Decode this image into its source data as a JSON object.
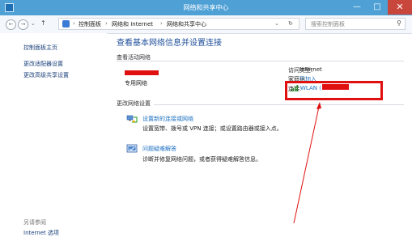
{
  "window": {
    "title": "网络和共享中心",
    "minimize": "—",
    "maximize": "□",
    "close": "✕"
  },
  "nav": {
    "back": "←",
    "forward": "→",
    "up": "↑",
    "refresh": "↻",
    "dropdown": "⌄"
  },
  "breadcrumb": [
    "控制面板",
    "网络和 Internet",
    "网络和共享中心"
  ],
  "breadcrumb_sep": "›",
  "search": {
    "placeholder": "搜索控制面板",
    "icon": "magnifier-icon"
  },
  "sidebar": {
    "links": [
      "控制面板主页",
      "更改适配器设置",
      "更改高级共享设置"
    ],
    "see_also_title": "另请参阅",
    "see_also": [
      "Internet 选项"
    ]
  },
  "main": {
    "heading": "查看基本网络信息并设置连接",
    "active_networks_title": "查看活动网络",
    "network_type": "专用网络",
    "access_type_label": "访问类型:",
    "access_type_value": "Internet",
    "homegroup_label": "家庭组:",
    "homegroup_value": "已加入",
    "connections_label": "连接:",
    "connection_value": "WLAN (",
    "change_settings_title": "更改网络设置",
    "tasks": [
      {
        "title": "设置新的连接或网络",
        "desc": "设置宽带、拨号或 VPN 连接；或设置路由器或接入点。",
        "icon": "network-setup-icon"
      },
      {
        "title": "问题疑难解答",
        "desc": "诊断并修复网络问题，或者获得疑难解答信息。",
        "icon": "troubleshoot-icon"
      }
    ]
  },
  "colors": {
    "titlebar": "#4ea0d5",
    "close": "#c9463d",
    "link": "#1a6fc2",
    "heading": "#1d4e9a",
    "annotation": "#e01010"
  }
}
